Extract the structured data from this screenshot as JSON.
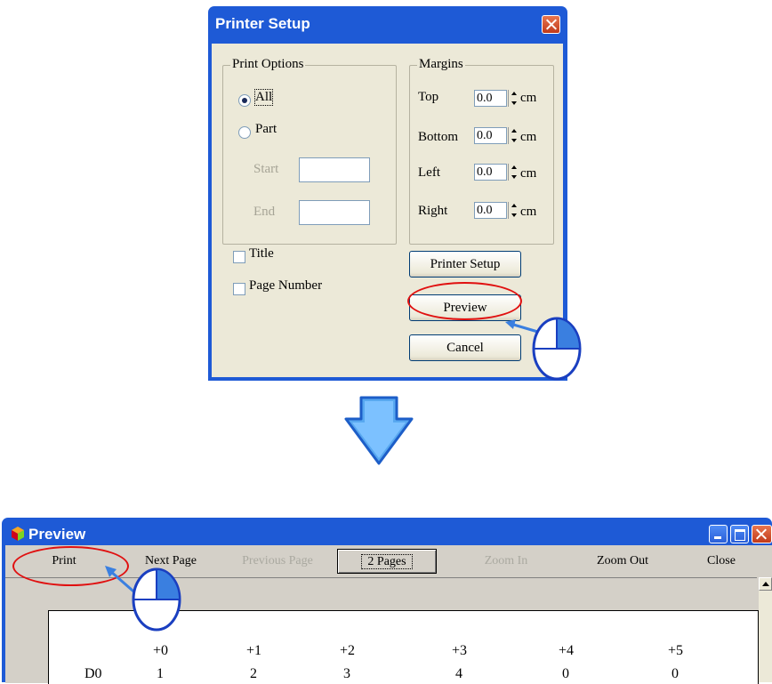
{
  "setup_dialog": {
    "title": "Printer Setup",
    "print_options": {
      "legend": "Print Options",
      "all_label": "All",
      "part_label": "Part",
      "start_label": "Start",
      "end_label": "End",
      "start_value": "",
      "end_value": ""
    },
    "margins": {
      "legend": "Margins",
      "top_label": "Top",
      "bottom_label": "Bottom",
      "left_label": "Left",
      "right_label": "Right",
      "top_value": "0.0",
      "bottom_value": "0.0",
      "left_value": "0.0",
      "right_value": "0.0",
      "unit": "cm"
    },
    "title_checkbox_label": "Title",
    "page_number_checkbox_label": "Page Number",
    "printer_setup_button": "Printer Setup",
    "preview_button": "Preview",
    "cancel_button": "Cancel"
  },
  "preview_window": {
    "title": "Preview",
    "toolbar": {
      "print": "Print",
      "next_page": "Next Page",
      "previous_page": "Previous Page",
      "two_pages": "2 Pages",
      "zoom_in": "Zoom In",
      "zoom_out": "Zoom Out",
      "close": "Close"
    },
    "table": {
      "headers": [
        "+0",
        "+1",
        "+2",
        "+3",
        "+4",
        "+5"
      ],
      "row_label": "D0",
      "row_values": [
        "1",
        "2",
        "3",
        "4",
        "0",
        "0"
      ]
    }
  },
  "colors": {
    "title_bar": "#1e5ad6",
    "dialog_face": "#ece9d8",
    "highlight_red": "#e01010",
    "pointer_blue": "#3a7fe0"
  },
  "icons": [
    "close-icon",
    "minimize-icon",
    "maximize-icon",
    "app-icon",
    "down-arrow-icon",
    "mouse-icon"
  ]
}
